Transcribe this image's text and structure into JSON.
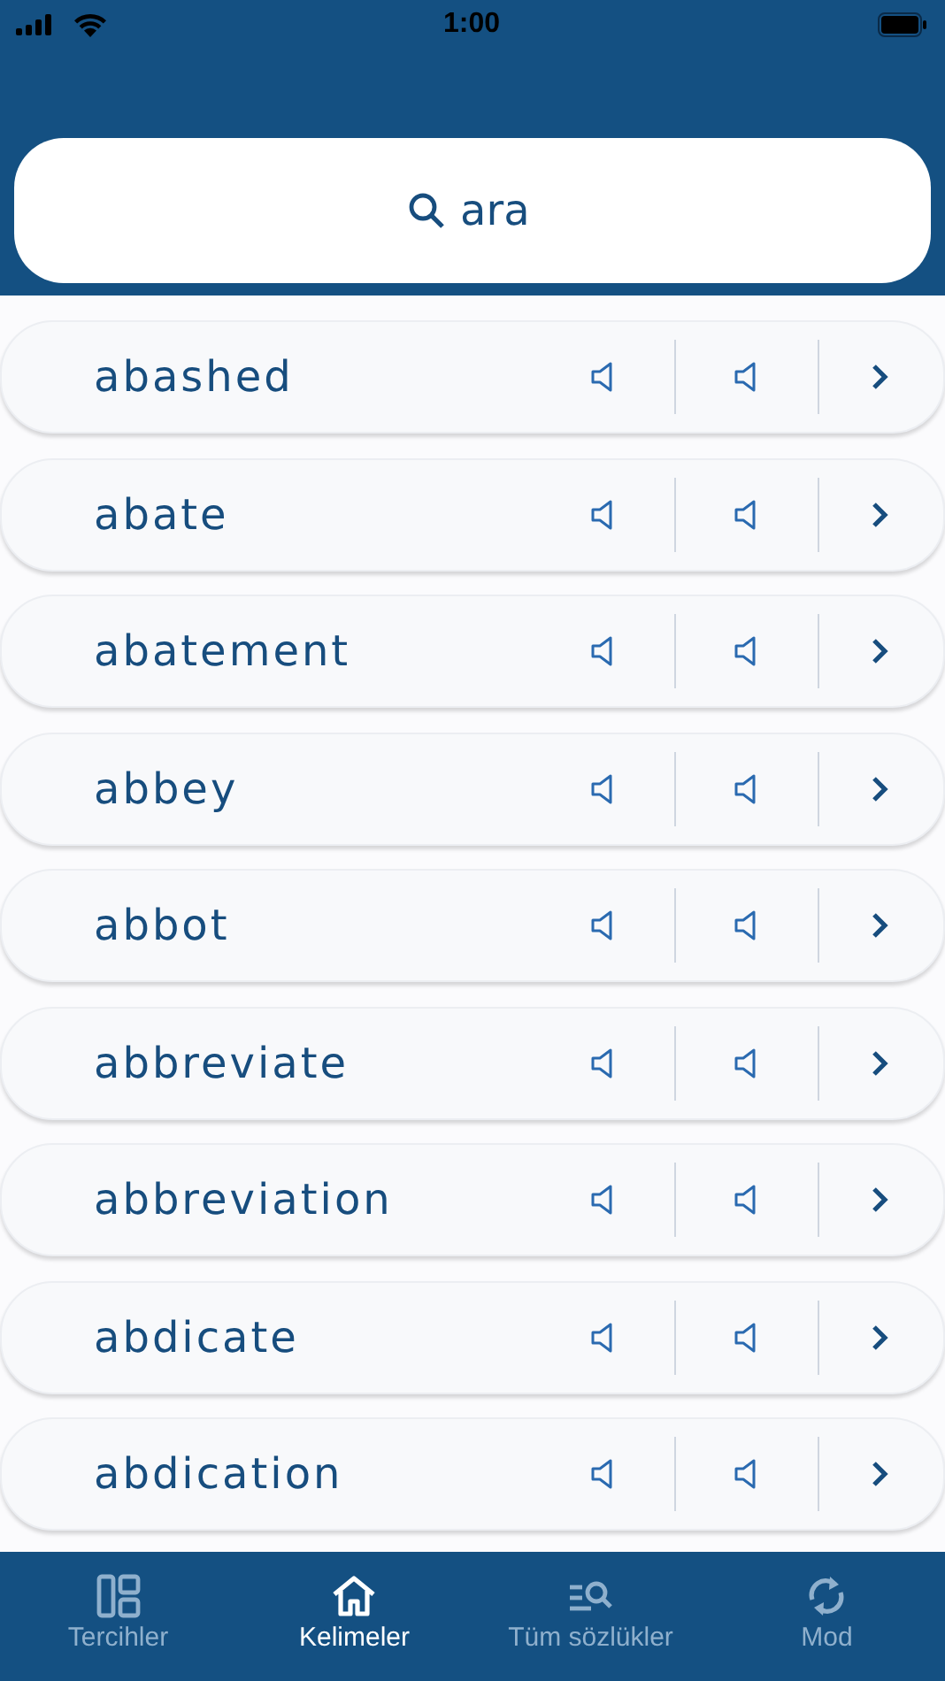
{
  "status_bar": {
    "time": "1:00"
  },
  "search": {
    "placeholder": "ara"
  },
  "words": [
    {
      "text": "abashed"
    },
    {
      "text": "abate"
    },
    {
      "text": "abatement"
    },
    {
      "text": "abbey"
    },
    {
      "text": "abbot"
    },
    {
      "text": "abbreviate"
    },
    {
      "text": "abbreviation"
    },
    {
      "text": "abdicate"
    },
    {
      "text": "abdication"
    }
  ],
  "tabs": [
    {
      "label": "Tercihler",
      "kind": "layout",
      "selected": false
    },
    {
      "label": "Kelimeler",
      "kind": "home",
      "selected": true
    },
    {
      "label": "Tüm sözlükler",
      "kind": "search-list",
      "selected": false
    },
    {
      "label": "Mod",
      "kind": "sync",
      "selected": false
    }
  ]
}
